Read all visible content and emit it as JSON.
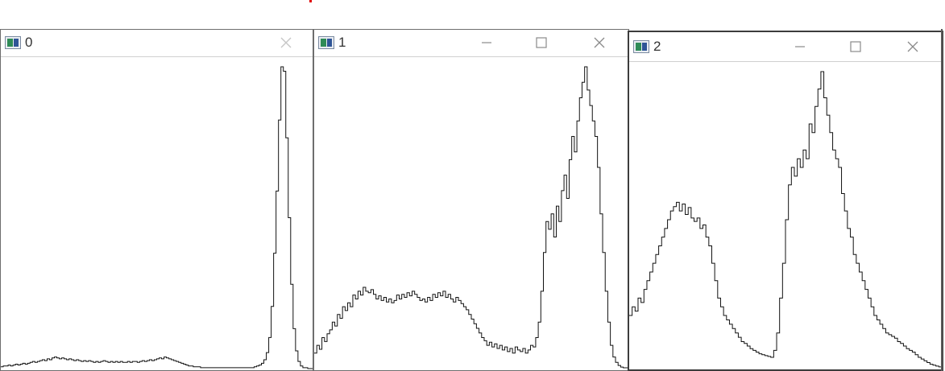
{
  "windows": [
    {
      "id": "w0",
      "title": "0",
      "controls": [
        "close"
      ],
      "histogram": [
        2,
        3,
        3,
        4,
        3,
        4,
        5,
        4,
        5,
        6,
        5,
        6,
        7,
        8,
        7,
        8,
        9,
        10,
        9,
        11,
        10,
        12,
        13,
        12,
        11,
        12,
        11,
        10,
        11,
        10,
        9,
        10,
        9,
        8,
        9,
        8,
        9,
        8,
        7,
        8,
        7,
        8,
        9,
        8,
        7,
        8,
        7,
        8,
        7,
        8,
        7,
        7,
        8,
        7,
        8,
        8,
        7,
        8,
        9,
        8,
        9,
        10,
        9,
        10,
        11,
        12,
        11,
        13,
        12,
        11,
        10,
        9,
        8,
        7,
        6,
        5,
        4,
        3,
        3,
        2,
        2,
        2,
        1,
        1,
        1,
        1,
        1,
        1,
        1,
        1,
        1,
        1,
        1,
        1,
        1,
        1,
        1,
        1,
        1,
        1,
        1,
        1,
        1,
        1,
        2,
        3,
        4,
        6,
        10,
        18,
        35,
        70,
        130,
        200,
        280,
        340,
        335,
        260,
        170,
        95,
        45,
        20,
        8,
        3,
        1,
        1,
        0,
        0
      ]
    },
    {
      "id": "w1",
      "title": "1",
      "controls": [
        "minimize",
        "maximize",
        "close"
      ],
      "histogram": [
        20,
        30,
        25,
        40,
        35,
        45,
        50,
        60,
        55,
        70,
        65,
        80,
        75,
        85,
        80,
        95,
        90,
        100,
        95,
        105,
        100,
        98,
        102,
        96,
        90,
        94,
        88,
        92,
        86,
        90,
        85,
        88,
        95,
        90,
        96,
        92,
        98,
        94,
        100,
        96,
        92,
        88,
        90,
        86,
        92,
        88,
        96,
        92,
        98,
        94,
        100,
        92,
        96,
        90,
        86,
        92,
        88,
        84,
        80,
        76,
        70,
        64,
        58,
        52,
        46,
        40,
        36,
        30,
        34,
        28,
        32,
        26,
        30,
        24,
        28,
        22,
        26,
        20,
        28,
        24,
        22,
        26,
        20,
        24,
        30,
        28,
        40,
        60,
        100,
        150,
        190,
        180,
        200,
        170,
        210,
        190,
        230,
        250,
        220,
        270,
        300,
        280,
        320,
        350,
        370,
        390,
        360,
        340,
        320,
        300,
        260,
        200,
        150,
        100,
        60,
        30,
        15,
        8,
        4,
        2,
        1,
        1
      ]
    },
    {
      "id": "w2",
      "title": "2",
      "controls": [
        "minimize",
        "maximize",
        "close"
      ],
      "histogram": [
        60,
        70,
        65,
        80,
        75,
        90,
        100,
        110,
        120,
        130,
        140,
        150,
        160,
        170,
        180,
        185,
        190,
        180,
        188,
        176,
        184,
        172,
        168,
        172,
        160,
        164,
        150,
        140,
        120,
        100,
        80,
        70,
        60,
        55,
        50,
        45,
        40,
        35,
        30,
        28,
        25,
        22,
        20,
        18,
        16,
        15,
        14,
        13,
        12,
        20,
        40,
        80,
        120,
        170,
        210,
        230,
        220,
        240,
        230,
        250,
        240,
        280,
        270,
        300,
        320,
        340,
        310,
        290,
        270,
        250,
        240,
        230,
        200,
        180,
        160,
        150,
        130,
        120,
        110,
        100,
        90,
        80,
        70,
        60,
        55,
        50,
        45,
        40,
        38,
        36,
        34,
        30,
        28,
        25,
        22,
        20,
        18,
        15,
        12,
        10,
        8,
        6,
        4,
        3,
        2,
        1
      ]
    }
  ]
}
